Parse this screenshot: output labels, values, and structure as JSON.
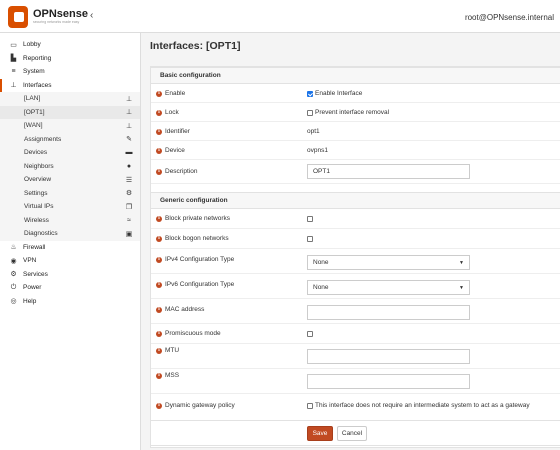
{
  "header": {
    "brand": "OPNsense",
    "tagline": "securing networks made easy",
    "collapse_icon": "chevron-left-icon",
    "user": "root@OPNsense.internal"
  },
  "sidebar": {
    "items": [
      {
        "label": "Lobby",
        "icon": "laptop-icon"
      },
      {
        "label": "Reporting",
        "icon": "chart-icon"
      },
      {
        "label": "System",
        "icon": "server-icon"
      },
      {
        "label": "Interfaces",
        "icon": "sitemap-icon"
      }
    ],
    "interfaces_sub": [
      {
        "label": "[LAN]",
        "icon": "sitemap-icon"
      },
      {
        "label": "[OPT1]",
        "icon": "sitemap-icon"
      },
      {
        "label": "[WAN]",
        "icon": "sitemap-icon"
      },
      {
        "label": "Assignments",
        "icon": "pencil-icon"
      },
      {
        "label": "Devices",
        "icon": "devices-icon"
      },
      {
        "label": "Neighbors",
        "icon": "users-icon"
      },
      {
        "label": "Overview",
        "icon": "list-icon"
      },
      {
        "label": "Settings",
        "icon": "gears-icon"
      },
      {
        "label": "Virtual IPs",
        "icon": "clone-icon"
      },
      {
        "label": "Wireless",
        "icon": "wifi-icon"
      },
      {
        "label": "Diagnostics",
        "icon": "medkit-icon"
      }
    ],
    "bottom_items": [
      {
        "label": "Firewall",
        "icon": "fire-icon"
      },
      {
        "label": "VPN",
        "icon": "globe-icon"
      },
      {
        "label": "Services",
        "icon": "cog-icon"
      },
      {
        "label": "Power",
        "icon": "plug-icon"
      },
      {
        "label": "Help",
        "icon": "support-icon"
      }
    ]
  },
  "main": {
    "title": "Interfaces: [OPT1]",
    "basic_section": "Basic configuration",
    "basic": {
      "enable_label": "Enable",
      "enable_value": "Enable Interface",
      "lock_label": "Lock",
      "lock_value": "Prevent interface removal",
      "identifier_label": "Identifier",
      "identifier_value": "opt1",
      "device_label": "Device",
      "device_value": "ovpns1",
      "description_label": "Description",
      "description_value": "OPT1"
    },
    "generic_section": "Generic configuration",
    "generic": {
      "block_private_label": "Block private networks",
      "block_bogon_label": "Block bogon networks",
      "ipv4_label": "IPv4 Configuration Type",
      "ipv4_value": "None",
      "ipv6_label": "IPv6 Configuration Type",
      "ipv6_value": "None",
      "mac_label": "MAC address",
      "promisc_label": "Promiscuous mode",
      "mtu_label": "MTU",
      "mss_label": "MSS",
      "dgw_label": "Dynamic gateway policy",
      "dgw_value": "This interface does not require an intermediate system to act as a gateway"
    },
    "save_label": "Save",
    "cancel_label": "Cancel"
  },
  "colors": {
    "accent": "#c14a22",
    "brand": "#d94f00",
    "checkbox": "#1a73e8"
  }
}
